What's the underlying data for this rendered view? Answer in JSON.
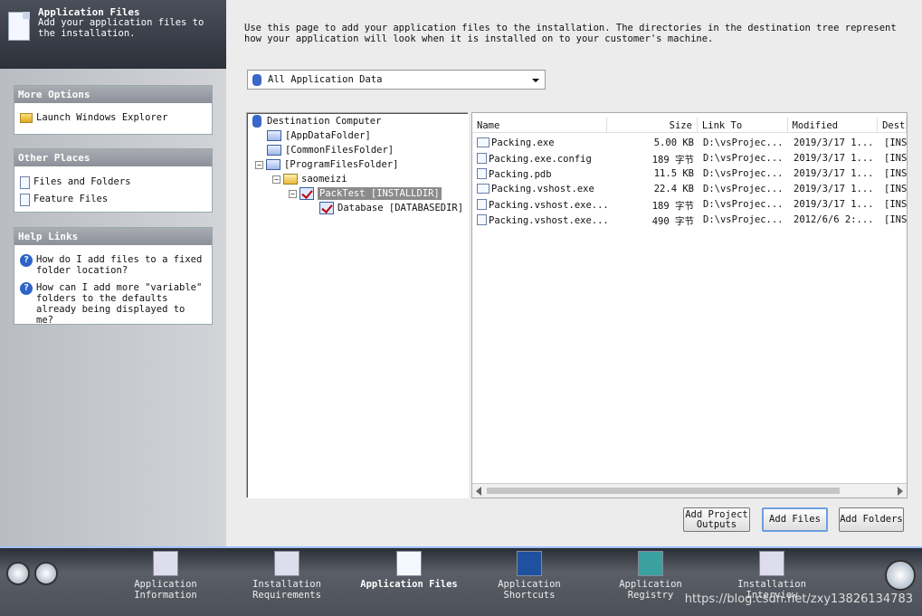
{
  "header": {
    "title": "Application Files",
    "subtitle": "Add your application files to the installation."
  },
  "more_options": {
    "title": "More Options",
    "items": [
      "Launch Windows Explorer"
    ]
  },
  "other_places": {
    "title": "Other Places",
    "items": [
      "Files and Folders",
      "Feature Files"
    ]
  },
  "help_links": {
    "title": "Help Links",
    "items": [
      "How do I add files to a fixed folder location?",
      "How can I add more \"variable\" folders to the defaults already being displayed to me?"
    ]
  },
  "description": "Use this page to add your application files to the installation. The directories in the destination tree represent how your application will look when it is installed on to your customer's machine.",
  "combo": {
    "value": "All Application Data"
  },
  "tree": {
    "root": "Destination Computer",
    "items": [
      "[AppDataFolder]",
      "[CommonFilesFolder]",
      "[ProgramFilesFolder]",
      "saomeizi",
      "PackTest [INSTALLDIR]",
      "Database [DATABASEDIR]"
    ]
  },
  "files": {
    "columns": [
      "Name",
      "Size",
      "Link To",
      "Modified",
      "Dest"
    ],
    "rows": [
      [
        "Packing.exe",
        "5.00 KB",
        "D:\\vsProjec...",
        "2019/3/17 1...",
        "[INS"
      ],
      [
        "Packing.exe.config",
        "189 字节",
        "D:\\vsProjec...",
        "2019/3/17 1...",
        "[INS"
      ],
      [
        "Packing.pdb",
        "11.5 KB",
        "D:\\vsProjec...",
        "2019/3/17 1...",
        "[INS"
      ],
      [
        "Packing.vshost.exe",
        "22.4 KB",
        "D:\\vsProjec...",
        "2019/3/17 1...",
        "[INS"
      ],
      [
        "Packing.vshost.exe...",
        "189 字节",
        "D:\\vsProjec...",
        "2019/3/17 1...",
        "[INS"
      ],
      [
        "Packing.vshost.exe...",
        "490 字节",
        "D:\\vsProjec...",
        "2012/6/6 2:...",
        "[INS"
      ]
    ]
  },
  "buttons": {
    "add_project_outputs": "Add Project Outputs",
    "add_files": "Add Files",
    "add_folders": "Add Folders"
  },
  "footer": {
    "nav": [
      "Application Information",
      "Installation Requirements",
      "Application Files",
      "Application Shortcuts",
      "Application Registry",
      "Installation Interview"
    ],
    "watermark": "https://blog.csdn.net/zxy13826134783"
  }
}
